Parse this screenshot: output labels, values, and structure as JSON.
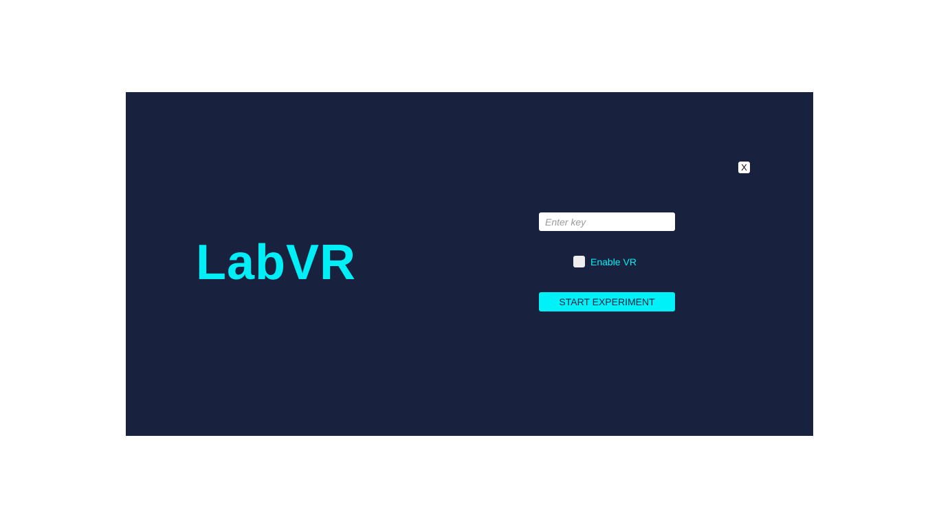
{
  "app": {
    "title": "LabVR"
  },
  "dialog": {
    "close_label": "X",
    "key_input": {
      "value": "",
      "placeholder": "Enter key"
    },
    "vr_toggle": {
      "label": "Enable VR",
      "checked": false
    },
    "start_button_label": "START EXPERIMENT"
  },
  "colors": {
    "panel_background": "#18223e",
    "accent": "#00eff7",
    "page_background": "#ffffff"
  }
}
